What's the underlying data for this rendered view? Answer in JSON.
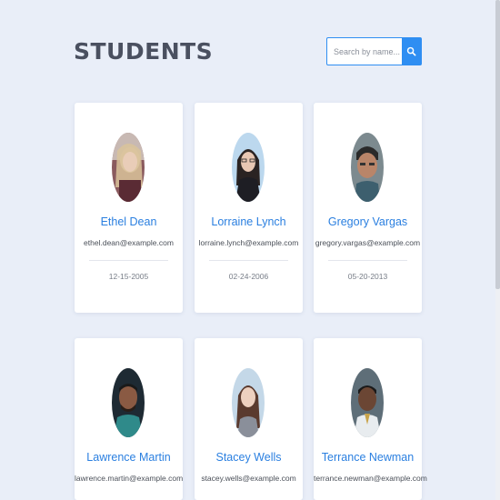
{
  "header": {
    "title": "STUDENTS"
  },
  "search": {
    "placeholder": "Search by name...",
    "value": ""
  },
  "students": [
    {
      "name": "Ethel Dean",
      "email": "ethel.dean@example.com",
      "date": "12-15-2005"
    },
    {
      "name": "Lorraine Lynch",
      "email": "lorraine.lynch@example.com",
      "date": "02-24-2006"
    },
    {
      "name": "Gregory Vargas",
      "email": "gregory.vargas@example.com",
      "date": "05-20-2013"
    },
    {
      "name": "Lawrence Martin",
      "email": "lawrence.martin@example.com",
      "date": ""
    },
    {
      "name": "Stacey Wells",
      "email": "stacey.wells@example.com",
      "date": ""
    },
    {
      "name": "Terrance Newman",
      "email": "terrance.newman@example.com",
      "date": ""
    }
  ],
  "colors": {
    "accent": "#2f8ef2",
    "name_text": "#2a7fe0",
    "background": "#e9eef8"
  }
}
